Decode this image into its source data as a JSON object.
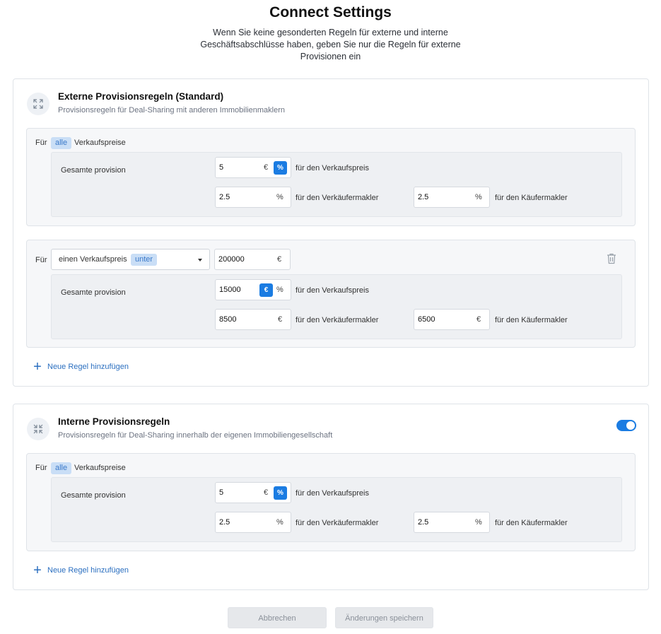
{
  "page": {
    "title": "Connect Settings",
    "subtitle": "Wenn Sie keine gesonderten Regeln für externe und interne Geschäftsabschlüsse haben, geben Sie nur die Regeln für externe Provisionen ein"
  },
  "external": {
    "title": "Externe Provisionsregeln (Standard)",
    "subtitle": "Provisionsregeln für Deal-Sharing mit anderen Immobilienmaklern",
    "icon": "expand-icon",
    "rule1": {
      "fuer": "Für",
      "chip": "alle",
      "suffix": "Verkaufspreise",
      "total_label": "Gesamte provision",
      "total_value": "5",
      "unit_euro": "€",
      "unit_percent": "%",
      "active_unit": "%",
      "for_price": "für den Verkaufspreis",
      "seller_value": "2.5",
      "seller_unit": "%",
      "for_seller": "für den Verkäufermakler",
      "buyer_value": "2.5",
      "buyer_unit": "%",
      "for_buyer": "für den Käufermakler"
    },
    "rule2": {
      "fuer": "Für",
      "select_text": "einen Verkaufspreis",
      "select_chip": "unter",
      "threshold_value": "200000",
      "threshold_unit": "€",
      "total_label": "Gesamte provision",
      "total_value": "15000",
      "unit_euro": "€",
      "unit_percent": "%",
      "active_unit": "€",
      "for_price": "für den Verkaufspreis",
      "seller_value": "8500",
      "seller_unit": "€",
      "for_seller": "für den Verkäufermakler",
      "buyer_value": "6500",
      "buyer_unit": "€",
      "for_buyer": "für den Käufermakler"
    },
    "add_rule": "Neue Regel hinzufügen"
  },
  "internal": {
    "title": "Interne Provisionsregeln",
    "subtitle": "Provisionsregeln für Deal-Sharing innerhalb der eigenen Immobiliengesellschaft",
    "icon": "collapse-icon",
    "toggle_on": true,
    "rule1": {
      "fuer": "Für",
      "chip": "alle",
      "suffix": "Verkaufspreise",
      "total_label": "Gesamte provision",
      "total_value": "5",
      "unit_euro": "€",
      "unit_percent": "%",
      "active_unit": "%",
      "for_price": "für den Verkaufspreis",
      "seller_value": "2.5",
      "seller_unit": "%",
      "for_seller": "für den Verkäufermakler",
      "buyer_value": "2.5",
      "buyer_unit": "%",
      "for_buyer": "für den Käufermakler"
    },
    "add_rule": "Neue Regel hinzufügen"
  },
  "footer": {
    "cancel": "Abbrechen",
    "save": "Änderungen speichern"
  },
  "colors": {
    "accent": "#1b7ce2",
    "chip_bg": "#c9def6",
    "link": "#2b6fc0"
  }
}
